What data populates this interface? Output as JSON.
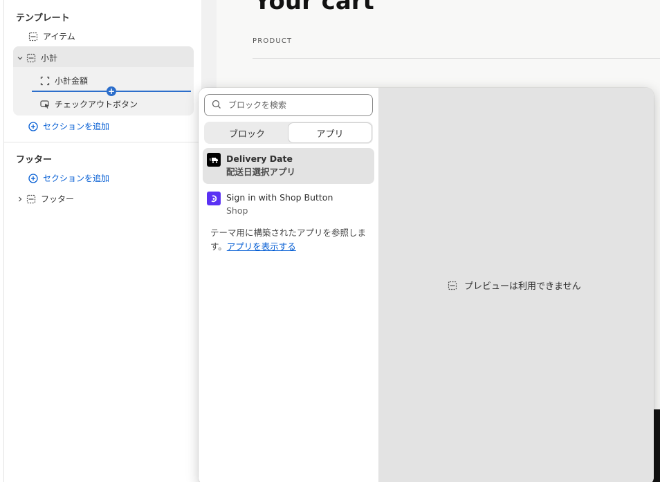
{
  "sidebar": {
    "template_title": "テンプレート",
    "items_label": "アイテム",
    "subtotal_label": "小計",
    "subtotal_amount_label": "小計金額",
    "checkout_button_label": "チェックアウトボタン",
    "add_section_label": "セクションを追加",
    "footer_title": "フッター",
    "footer_add_section_label": "セクションを追加",
    "footer_item_label": "フッター"
  },
  "canvas": {
    "title": "Your cart",
    "product_column": "PRODUCT"
  },
  "popover": {
    "search_placeholder": "ブロックを検索",
    "tabs": [
      {
        "label": "ブロック",
        "active": false
      },
      {
        "label": "アプリ",
        "active": true
      }
    ],
    "apps": [
      {
        "name": "Delivery Date",
        "subtitle": "配送日選択アプリ",
        "icon": "delivery-truck-icon",
        "icon_bg": "#000000"
      },
      {
        "name": "Sign in with Shop Button",
        "subtitle": "Shop",
        "icon": "shop-icon",
        "icon_bg": "#5a31f4"
      }
    ],
    "browse_text": "テーマ用に構築されたアプリを参照します。",
    "browse_link": "アプリを表示する",
    "preview_unavailable": "プレビューは利用できません"
  },
  "colors": {
    "accent_blue": "#005bd3",
    "insert_blue": "#2c6ecb",
    "shop_purple": "#5a31f4"
  }
}
